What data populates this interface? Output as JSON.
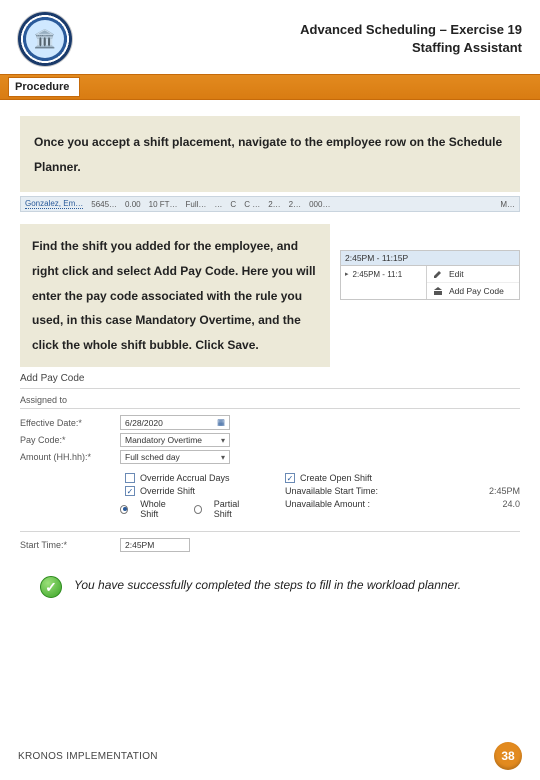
{
  "header": {
    "title_line1": "Advanced Scheduling – Exercise 19",
    "title_line2": "Staffing Assistant"
  },
  "procedure_label": "Procedure",
  "step1_text": "Once you accept a shift placement, navigate to the employee row on the Schedule Planner.",
  "sched_row": {
    "emp": "Gonzalez, Em…",
    "c1": "5645…",
    "c2": "0.00",
    "c3": "10 FT…",
    "c4": "Full…",
    "c5": "…",
    "c6": "C",
    "c7": "C …",
    "c8": "2…",
    "c9": "2…",
    "c10": "000…",
    "c11": "M…"
  },
  "step2_text": "Find the shift you added for the employee, and right click and select Add Pay Code. Here you will enter the pay code associated with the rule you used, in this case Mandatory Overtime, and the click the whole shift bubble. Click Save.",
  "context_menu": {
    "header": "2:45PM - 11:15P",
    "left_time": "2:45PM - 11:1",
    "item_edit": "Edit",
    "item_addpay": "Add Pay Code"
  },
  "form": {
    "title": "Add Pay Code",
    "assigned_label": "Assigned to",
    "eff_date_label": "Effective Date:*",
    "eff_date_value": "6/28/2020",
    "paycode_label": "Pay Code:*",
    "paycode_value": "Mandatory Overtime",
    "amount_label": "Amount (HH.hh):*",
    "amount_value": "Full sched day",
    "override_accrual": "Override Accrual Days",
    "create_open_shift": "Create Open Shift",
    "override_shift": "Override Shift",
    "whole_shift": "Whole Shift",
    "partial_shift": "Partial Shift",
    "unavail_start_label": "Unavailable Start Time:",
    "unavail_start_value": "2:45PM",
    "unavail_amount_label": "Unavailable Amount :",
    "unavail_amount_value": "24.0",
    "start_time_label": "Start Time:*",
    "start_time_value": "2:45PM"
  },
  "success_text": "You have successfully completed the steps to fill in the workload planner.",
  "footer": {
    "label": "KRONOS IMPLEMENTATION",
    "page": "38"
  }
}
